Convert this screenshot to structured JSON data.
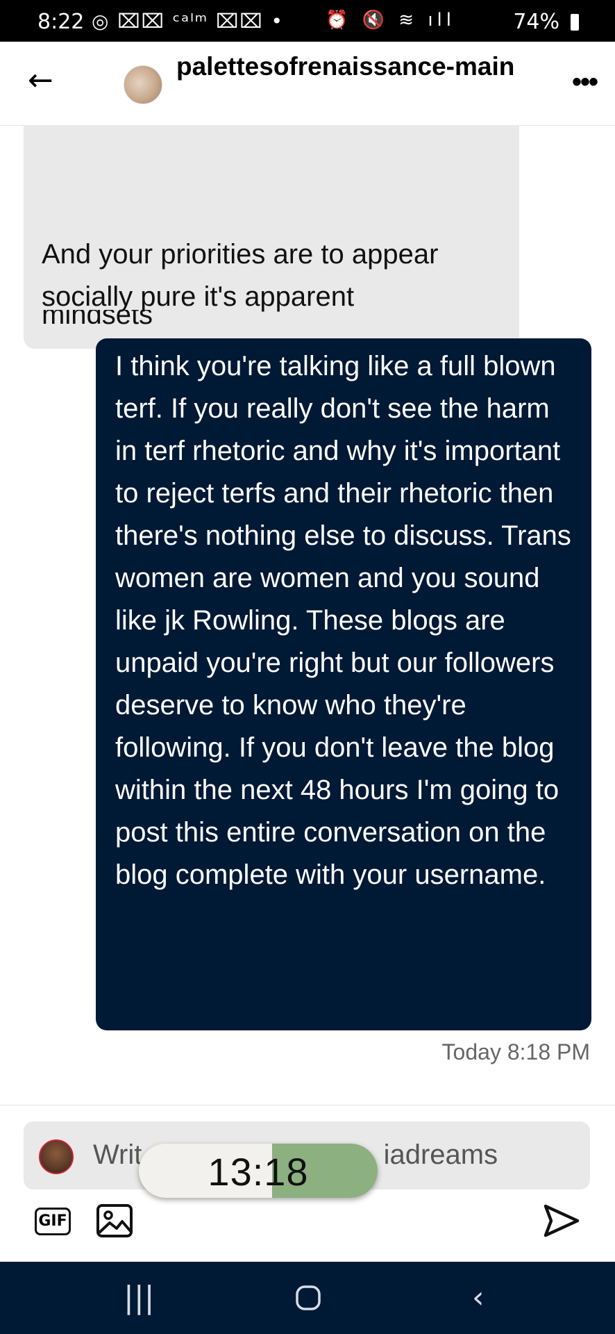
{
  "status_bar": {
    "time": "8:22",
    "battery": "74%"
  },
  "header": {
    "blog_name": "palettesofrenaissance-main"
  },
  "messages": [
    {
      "side": "incoming",
      "text": "telling about actual values and mindsets"
    },
    {
      "side": "incoming",
      "text": "And your priorities are to appear socially pure it's apparent"
    },
    {
      "side": "outgoing",
      "text": "I think you're talking like a full blown terf. If you really don't see the harm in terf rhetoric and why it's important to reject terfs and their rhetoric then there's nothing else to discuss. Trans women are women and you sound like jk Rowling. These blogs are unpaid you're right but our followers deserve to know who they're following.  If you don't leave the blog within the next 48 hours I'm going to post this entire conversation on the blog complete with your username."
    }
  ],
  "timestamp": "Today 8:18 PM",
  "composer": {
    "placeholder_start": "Writ",
    "placeholder_end": "iadreams"
  },
  "timer_overlay": {
    "label": "13:18"
  },
  "buttons": {
    "gif": "GIF"
  },
  "colors": {
    "outgoing_bubble": "#001935",
    "incoming_bubble": "#e9e9e9",
    "navbar": "#001935",
    "timer_green": "#8cb07f"
  },
  "icons": {
    "back": "arrow-left-icon",
    "more": "more-dots-icon",
    "image": "image-icon",
    "send": "send-icon",
    "nav_recents": "recents-icon",
    "nav_home": "home-icon",
    "nav_back": "chevron-left-icon"
  }
}
